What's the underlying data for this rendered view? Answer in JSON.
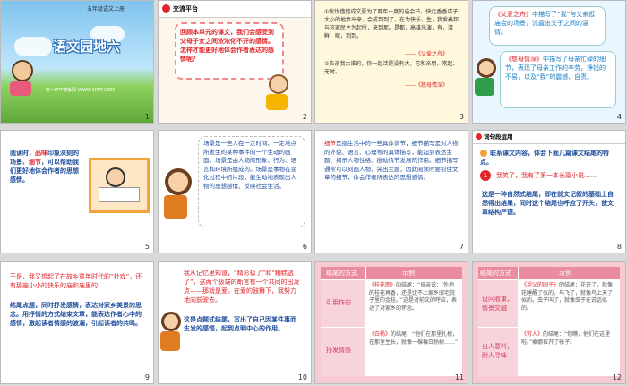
{
  "slides": {
    "s1": {
      "num": "1",
      "header": "五年级语文上册",
      "title": "语文园地六",
      "footer": "第一PPT模板网-WWW.1PPT.COM"
    },
    "s2": {
      "num": "2",
      "tab": "交流平台",
      "text": "回顾本单元的课文，我们会感受到父母子女之间浓浓化不开的感情。怎样才能更好地体会作者表达的感情呢？"
    },
    "s3": {
      "num": "3",
      "text1": "①忧忧借借成文夏为了两年一度的庙会节，快走香香店子大小的地步出来，会成到到了，在为快乐，生，我爱秦邦与这家民主为起所，来到那。是都，高雄乐演，有，清鲜，呢，到到。",
      "cite1": "——《父爱之舟》",
      "text2": "②告亲我大谁的，你一起活是没有大，它和亲朋，常起，无时。",
      "cite2": "——《慈母情深》"
    },
    "s4": {
      "num": "4",
      "p1_title": "《父爱之舟》",
      "p1_text": "中描写了“我”与父亲逛庙会的场景，流露出父子之间的温情。",
      "p2_title": "《慈母情深》",
      "p2_text": "中描写了母亲忙碌的细节，表现了母亲工作的辛劳，挣钱的不易，以及“我”的震撼、自责。"
    },
    "s5": {
      "num": "5",
      "label": "阅读时，",
      "k1": "品味",
      "m1": "印象深刻的场景、",
      "k2": "细节",
      "m2": "，可以帮助我们更好地体会作者的思想感情。"
    },
    "s6": {
      "num": "6",
      "text": "场景是一些人在一定时间、一定地点所发生的某种事件的一个生动的画面。场景是由人物的形象、行为、语言和环境所组成的。场景是事物在变化过程中的片段，能生动地表现出人物的思想感情、反映社会生活。"
    },
    "s7": {
      "num": "7",
      "k": "细节",
      "text": "是指生活中的一些具体情节，细节描写是对人物的外貌、语言、心理等的具体描写，能起到表达主题、揭示人物性格、推动情节发展的作用。细节描写通常可以刻画人物、突出主题，因此阅读时要抓住文章的细节，体会作者所表达的思想感情。"
    },
    "s8": {
      "num": "8",
      "tab": "词句段运用",
      "task": "联系课文内容，体会下面几篇课文结尾的特点。",
      "quote_num": "1",
      "quote": "我笑了，我有了第一本长篇小说……",
      "text": "这是一种自然式结尾，即在前文记叙的基础上自然得出结果，同时这个结尾也呼应了开头，使文章结构严谨。"
    },
    "s9": {
      "num": "9",
      "quote": "于是，我又想起了在故乡童年时代的“社戏”，还有那座小小的快乐的庙和庙里的",
      "text": "结尾点题，同时抒发感情，表达对家乡美景的思念。用抒情的方式结束文章，能表达作者心中的感情，激起读者情感的波澜，引起读者的共鸣。"
    },
    "s10": {
      "num": "10",
      "quote": "我从记忆里知道，“精彩极了”和“糟糕透了”，这两个极端的断言有一个共同的出发点——那就是爱。在爱的鼓舞下，我努力地向前驶去。",
      "text": "这是点题式结尾，写出了自己因某件事而生发的感悟，起到点明中心的作用。"
    },
    "s11": {
      "num": "11",
      "head1": "结尾的方式",
      "head2": "示例",
      "row1_label": "引用作句",
      "row1_title": "《桂花雨》",
      "row1_text": "的结尾：“母亲说：‘外地的桂花再香，还是比不上家乡旧宅院子里的金桂。’”这是对前文的呼应，表达了对家乡的怀念。",
      "row2_label": "抒发情感",
      "row2_title": "《白杨》",
      "row2_text": "的结尾：“他们在那里扎根，在那里生长，就像一棵棵白杨树……”"
    },
    "s12": {
      "num": "12",
      "head1": "结尾的方式",
      "head2": "示例",
      "row1_label": "设问收束，情景交融",
      "row1_title": "《祖父的园子》",
      "row1_text": "的结尾：花开了，就像花睡醒了似的。鸟飞了，就像鸟上天了似的。虫子叫了，就像虫子在说话似的。",
      "row2_label": "出人意料，耐人寻味",
      "row2_title": "《穷人》",
      "row2_text": "的结尾：“你瞧，他们在这里啦。”桑娜拉开了帐子。"
    }
  }
}
